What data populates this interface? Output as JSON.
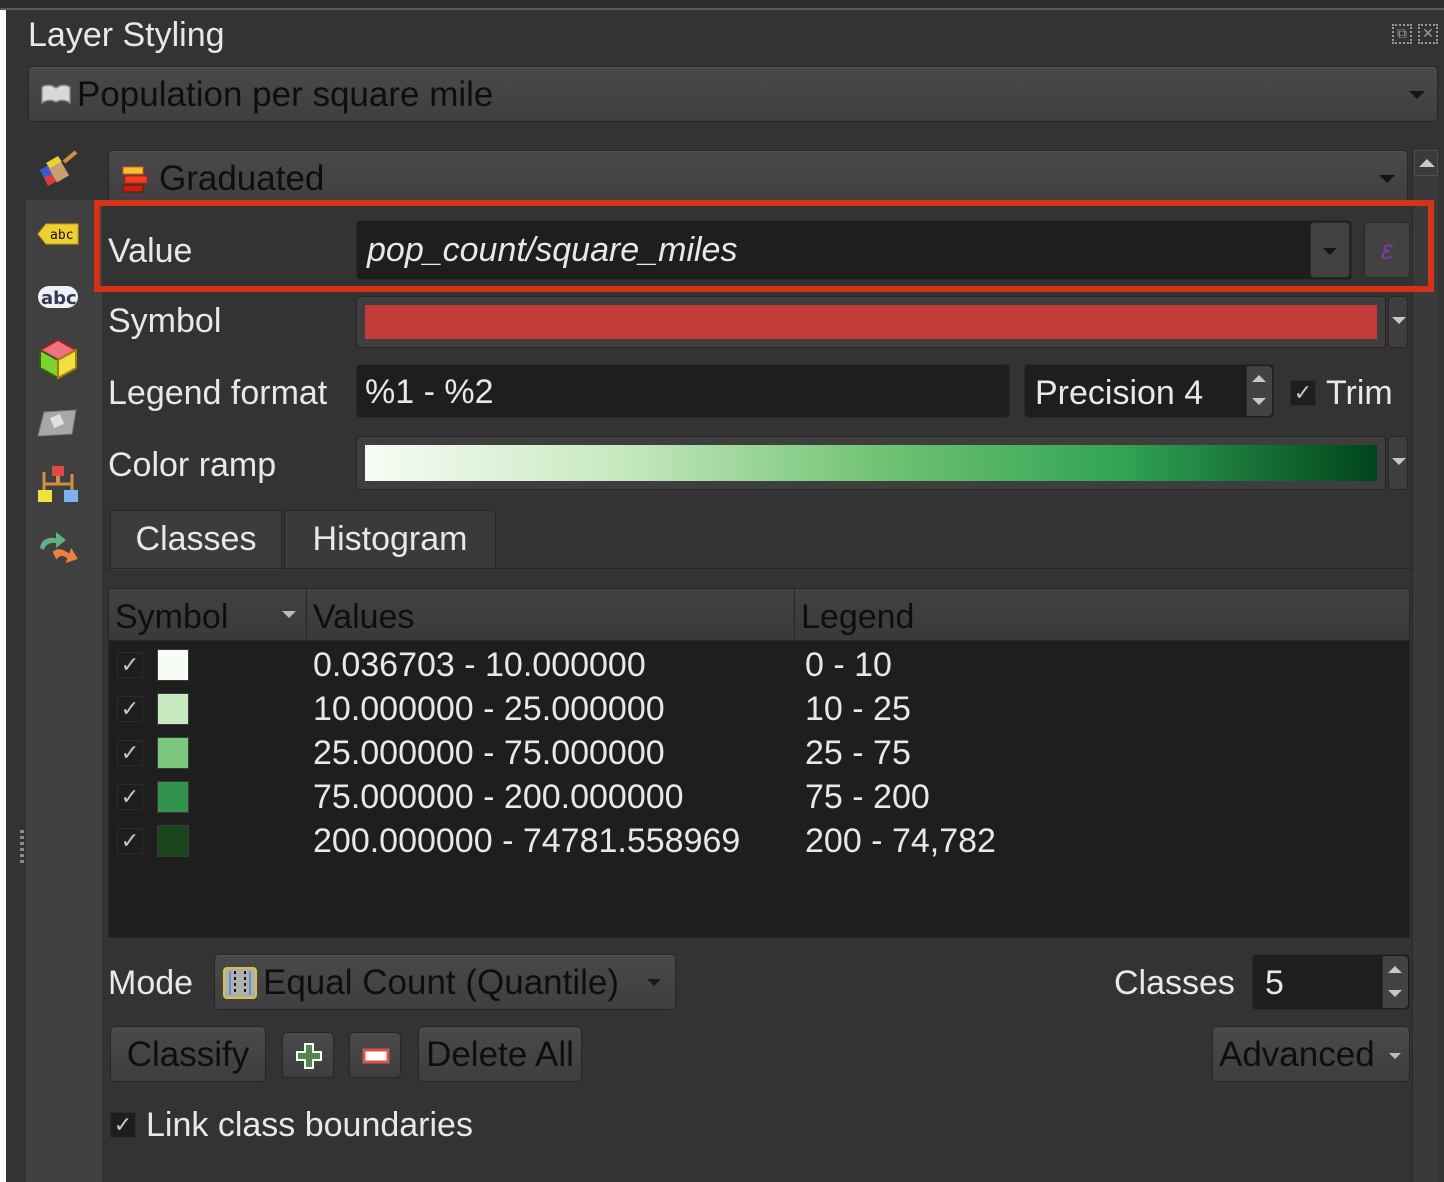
{
  "panel": {
    "title": "Layer Styling",
    "dock_float_icon": "float-icon",
    "dock_close_icon": "close-icon"
  },
  "layer_selector": {
    "icon": "polygon-layer-icon",
    "value": "Population per square mile"
  },
  "sidebar": {
    "items": [
      {
        "name": "symbology",
        "icon": "paintbrush-icon"
      },
      {
        "name": "labels",
        "icon": "label-callout-icon"
      },
      {
        "name": "masks",
        "icon": "abc-mask-icon"
      },
      {
        "name": "3d-view",
        "icon": "cube-icon"
      },
      {
        "name": "diagrams",
        "icon": "map-diagram-icon"
      },
      {
        "name": "rendering",
        "icon": "style-manager-icon"
      },
      {
        "name": "history",
        "icon": "undo-redo-icon"
      }
    ]
  },
  "renderer": {
    "icon": "graduated-icon",
    "value": "Graduated"
  },
  "form": {
    "value_label": "Value",
    "value_expression": "pop_count/square_miles",
    "expression_button_glyph": "ε",
    "symbol_label": "Symbol",
    "symbol_color": "#c43c3a",
    "legend_format_label": "Legend format",
    "legend_format_value": "%1 - %2",
    "precision_value": "Precision 4",
    "trim_label": "Trim",
    "trim_checked": true,
    "check_glyph": "✓",
    "color_ramp_label": "Color ramp",
    "color_ramp_stops": [
      "#f7fcf5",
      "#c7e9c0",
      "#74c476",
      "#31a354",
      "#00441b"
    ]
  },
  "tabs": [
    {
      "label": "Classes",
      "active": true
    },
    {
      "label": "Histogram",
      "active": false
    }
  ],
  "table": {
    "headers": [
      "Symbol",
      "Values",
      "Legend"
    ],
    "rows": [
      {
        "checked": true,
        "color": "#f7fcf5",
        "values": "0.036703 - 10.000000",
        "legend": "0 - 10"
      },
      {
        "checked": true,
        "color": "#c7e9c0",
        "values": "10.000000 - 25.000000",
        "legend": "10 - 25"
      },
      {
        "checked": true,
        "color": "#7bc87c",
        "values": "25.000000 - 75.000000",
        "legend": "25 - 75"
      },
      {
        "checked": true,
        "color": "#31934c",
        "values": "75.000000 - 200.000000",
        "legend": "75 - 200"
      },
      {
        "checked": true,
        "color": "#1a441c",
        "values": "200.000000 - 74781.558969",
        "legend": "200 - 74,782"
      }
    ]
  },
  "mode": {
    "label": "Mode",
    "icon": "quantile-icon",
    "value": "Equal Count (Quantile)"
  },
  "classes": {
    "label": "Classes",
    "value": "5"
  },
  "buttons": {
    "classify": "Classify",
    "add": "add-class-icon",
    "remove": "remove-class-icon",
    "delete_all": "Delete All",
    "advanced": "Advanced"
  },
  "link_boundaries": {
    "label": "Link class boundaries",
    "checked": true
  },
  "colors": {
    "highlight": "#d43219",
    "panel_bg": "#333333",
    "field_bg": "#1e1e1e"
  }
}
